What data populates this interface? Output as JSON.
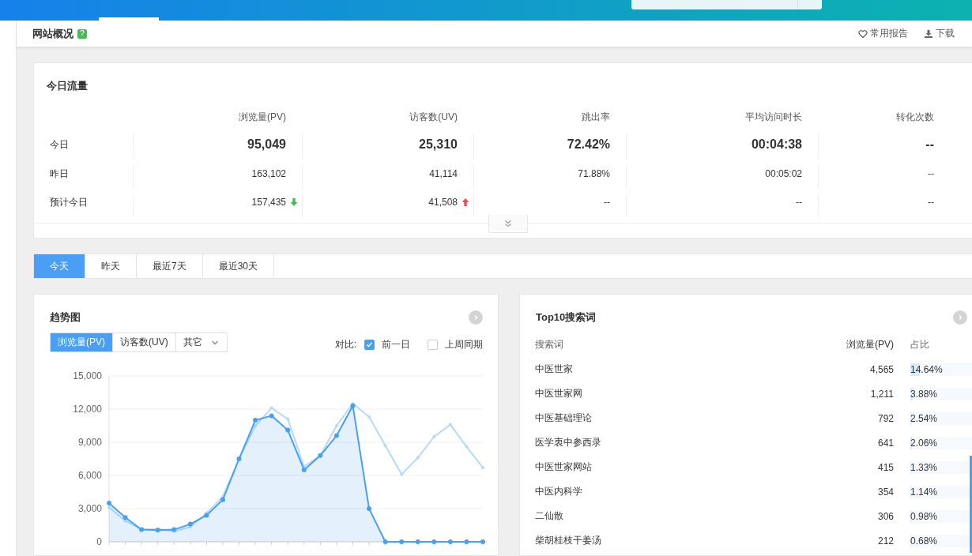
{
  "header": {
    "title": "网站概况",
    "help": "?",
    "actions": [
      {
        "label": "常用报告"
      },
      {
        "label": "下载"
      }
    ]
  },
  "today_traffic": {
    "title": "今日流量",
    "columns": [
      "浏览量(PV)",
      "访客数(UV)",
      "跳出率",
      "平均访问时长",
      "转化次数"
    ],
    "rows": [
      {
        "label": "今日",
        "kind": "main",
        "cells": [
          {
            "value": "95,049"
          },
          {
            "value": "25,310"
          },
          {
            "value": "72.42%"
          },
          {
            "value": "00:04:38"
          },
          {
            "value": "--"
          }
        ]
      },
      {
        "label": "昨日",
        "kind": "plain",
        "cells": [
          {
            "value": "163,102"
          },
          {
            "value": "41,114"
          },
          {
            "value": "71.88%"
          },
          {
            "value": "00:05:02"
          },
          {
            "value": "--"
          }
        ]
      },
      {
        "label": "预计今日",
        "kind": "plain",
        "cells": [
          {
            "value": "157,435",
            "up": false
          },
          {
            "value": "41,508",
            "up": true
          },
          {
            "value": "--"
          },
          {
            "value": "--"
          },
          {
            "value": "--"
          }
        ]
      }
    ]
  },
  "range_tabs": [
    {
      "label": "今天",
      "selected": true
    },
    {
      "label": "昨天",
      "selected": false
    },
    {
      "label": "最近7天",
      "selected": false
    },
    {
      "label": "最近30天",
      "selected": false
    }
  ],
  "trend": {
    "title": "趋势图",
    "metric_tabs": [
      {
        "label": "浏览量(PV)",
        "kind": "button",
        "selected": true
      },
      {
        "label": "访客数(UV)",
        "kind": "button",
        "selected": false
      },
      {
        "label": "其它",
        "kind": "dropdown",
        "selected": false
      }
    ],
    "compare_label": "对比:",
    "compare": [
      {
        "label": "前一日",
        "checked": true
      },
      {
        "label": "上周同期",
        "checked": false
      }
    ],
    "chart_data": {
      "type": "line",
      "grid": true,
      "ylim": [
        0,
        15000
      ],
      "yticks": [
        {
          "value": 0,
          "label": "0"
        },
        {
          "value": 3000,
          "label": "3,000"
        },
        {
          "value": 6000,
          "label": "6,000"
        },
        {
          "value": 9000,
          "label": "9,000"
        },
        {
          "value": 12000,
          "label": "12,000"
        },
        {
          "value": 15000,
          "label": "15,000"
        }
      ],
      "series": [
        {
          "color": "#4aa0f0",
          "marker": true,
          "values": [
            3500,
            2200,
            1100,
            1050,
            1100,
            1600,
            2400,
            3800,
            7500,
            11000,
            11400,
            10100,
            6500,
            7800,
            9600,
            12300,
            3000,
            0,
            0,
            0,
            0,
            0,
            0,
            0
          ]
        },
        {
          "color": "#b5d9fb",
          "marker": true,
          "values": [
            3100,
            1900,
            1100,
            1150,
            950,
            1350,
            2600,
            4100,
            7500,
            10500,
            12100,
            11100,
            6800,
            7800,
            10500,
            12500,
            11300,
            8700,
            6100,
            7600,
            9500,
            10600,
            8600,
            6700
          ]
        }
      ]
    }
  },
  "top_keywords": {
    "title": "Top10搜索词",
    "columns": [
      "搜索词",
      "浏览量(PV)",
      "占比"
    ],
    "rows": [
      {
        "keyword": "中医世家",
        "pv": "4,565",
        "share": "14.64%",
        "level": 0.1464
      },
      {
        "keyword": "中医世家网",
        "pv": "1,211",
        "share": "3.88%",
        "level": 0.0388
      },
      {
        "keyword": "中医基础理论",
        "pv": "792",
        "share": "2.54%",
        "level": 0.0254
      },
      {
        "keyword": "医学衷中参西录",
        "pv": "641",
        "share": "2.06%",
        "level": 0.0206
      },
      {
        "keyword": "中医世家网站",
        "pv": "415",
        "share": "1.33%",
        "level": 0.0133
      },
      {
        "keyword": "中医内科学",
        "pv": "354",
        "share": "1.14%",
        "level": 0.0114
      },
      {
        "keyword": "二仙散",
        "pv": "306",
        "share": "0.98%",
        "level": 0.0098
      },
      {
        "keyword": "柴胡桂枝干姜汤",
        "pv": "212",
        "share": "0.68%",
        "level": 0.0068
      }
    ]
  }
}
